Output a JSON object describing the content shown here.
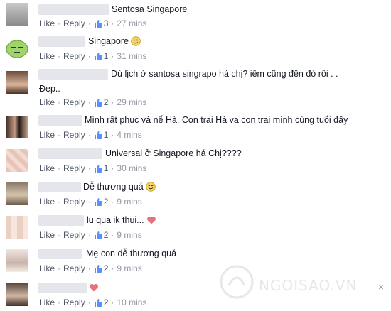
{
  "comments": [
    {
      "text": "Sentosa Singapore",
      "like_label": "Like",
      "reply_label": "Reply",
      "likes": "3",
      "time": "27 mins",
      "emoji": ""
    },
    {
      "text": "Singapore",
      "like_label": "Like",
      "reply_label": "Reply",
      "likes": "1",
      "time": "31 mins",
      "emoji": "smile"
    },
    {
      "text": "Dù lịch ở santosa singrapo há chị? iêm cũng đến đó rồi . .",
      "text2": "Đẹp..",
      "like_label": "Like",
      "reply_label": "Reply",
      "likes": "2",
      "time": "29 mins",
      "emoji": ""
    },
    {
      "text": "Mình rất phục và nể Hà. Con trai Hà va con trai mình cùng tuổi đấy",
      "like_label": "Like",
      "reply_label": "Reply",
      "likes": "1",
      "time": "4 mins",
      "emoji": ""
    },
    {
      "text": "Universal ở Singapore há Chị????",
      "like_label": "Like",
      "reply_label": "Reply",
      "likes": "1",
      "time": "30 mins",
      "emoji": ""
    },
    {
      "text": "Dễ thương quá",
      "like_label": "Like",
      "reply_label": "Reply",
      "likes": "2",
      "time": "9 mins",
      "emoji": "smile"
    },
    {
      "text": "lu qua ik thui...",
      "like_label": "Like",
      "reply_label": "Reply",
      "likes": "2",
      "time": "9 mins",
      "emoji": "heart"
    },
    {
      "text": "Mẹ con dễ thương quá",
      "like_label": "Like",
      "reply_label": "Reply",
      "likes": "2",
      "time": "9 mins",
      "emoji": ""
    },
    {
      "text": "",
      "like_label": "Like",
      "reply_label": "Reply",
      "likes": "2",
      "time": "10 mins",
      "emoji": "heart"
    }
  ],
  "close_glyph": "×",
  "watermark": "NGOISAO.VN",
  "colors": {
    "link": "#4e5665",
    "meta": "#9197a3",
    "thumb": "#5890ff",
    "heart": "#e9717a",
    "smile": "#f5c33b"
  }
}
